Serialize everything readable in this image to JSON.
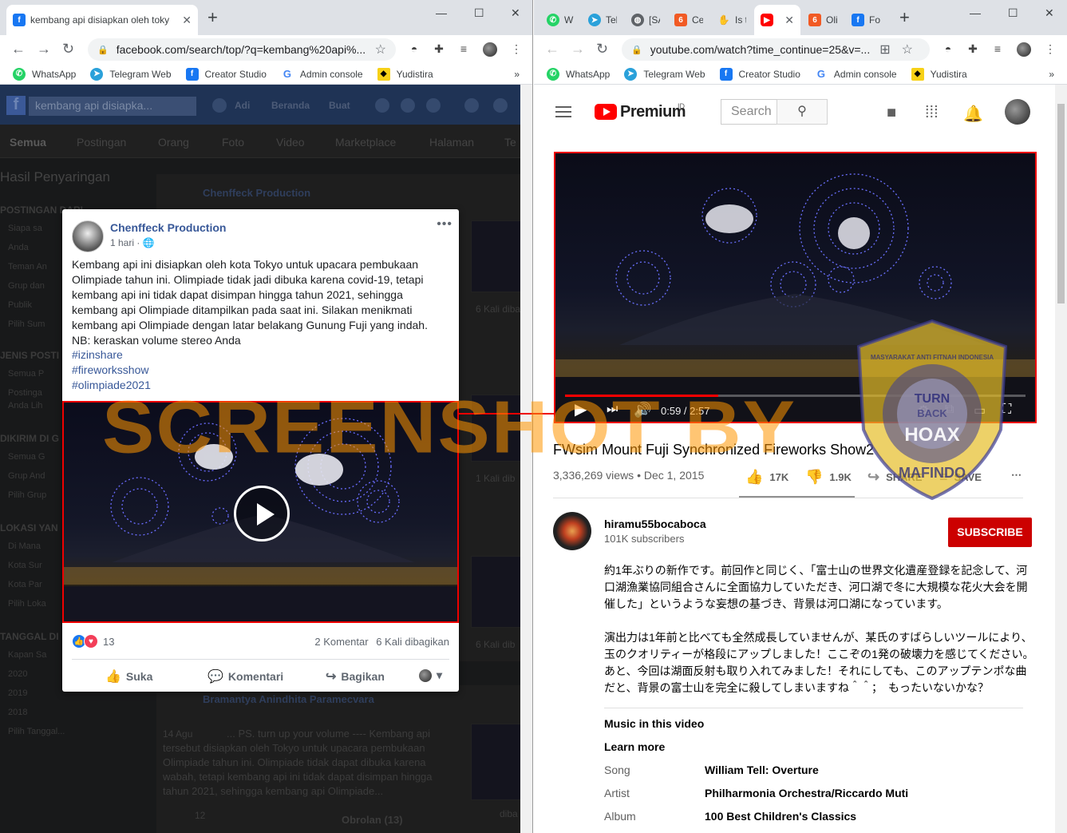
{
  "left_window": {
    "tab_title": "kembang api disiapkan oleh toky",
    "url": "facebook.com/search/top/?q=kembang%20api%...",
    "bookmarks": [
      "WhatsApp",
      "Telegram Web",
      "Creator Studio",
      "Admin console",
      "Yudistira"
    ]
  },
  "right_window": {
    "tabs": [
      "Wh",
      "Tel",
      "[SA",
      "Ce",
      "Is t",
      "",
      "Oli",
      "Fo"
    ],
    "url": "youtube.com/watch?time_continue=25&v=...",
    "bookmarks": [
      "WhatsApp",
      "Telegram Web",
      "Creator Studio",
      "Admin console",
      "Yudistira"
    ]
  },
  "fb_background": {
    "search_text": "kembang api disiapka...",
    "nav": [
      "Adi",
      "Beranda",
      "Buat"
    ],
    "tabs": [
      "Semua",
      "Postingan",
      "Orang",
      "Foto",
      "Video",
      "Marketplace",
      "Halaman",
      "Te"
    ],
    "filters_heading": "Hasil Penyaringan",
    "sections": [
      {
        "title": "POSTINGAN DARI",
        "items": [
          "Siapa sa",
          "Anda",
          "Teman An",
          "Grup dan",
          "Publik",
          "Pilih Sum"
        ]
      },
      {
        "title": "JENIS POSTI",
        "items": [
          "Semua P",
          "Postinga",
          "Anda Lih"
        ]
      },
      {
        "title": "DIKIRIM DI G",
        "items": [
          "Semua G",
          "Grup And",
          "Pilih Grup"
        ]
      },
      {
        "title": "LOKASI YAN",
        "items": [
          "Di Mana",
          "Kota Sur",
          "Kota Par",
          "Pilih Loka"
        ]
      },
      {
        "title": "TANGGAL DI",
        "items": [
          "Kapan Sa",
          "2020",
          "2019",
          "2018",
          "Pilih Tanggal..."
        ]
      }
    ],
    "post1_name": "Chenffeck Production",
    "post1_side_1": "6 Kali diba",
    "post1_side_2": "1 Kali dib",
    "post1_side_3": "6 Kali dib",
    "post2_name": "Bramantya Anindhita Paramecvara",
    "post2_date": "14 Agu",
    "post2_text": "... PS. turn up your volume ---- Kembang api tersebut disiapkan oleh Tokyo untuk upacara pembukaan Olimpiade tahun ini. Olimpiade tidak dapat dibuka karena wabah, tetapi kembang api ini tidak dapat disimpan hingga tahun 2021, sehingga kembang api Olimpiade...",
    "post2_count": "12",
    "chat_label": "Obrolan (13)",
    "chat_side": "diba"
  },
  "fb_post": {
    "author": "Chenffeck Production",
    "time": "1 hari",
    "text": "Kembang api ini disiapkan oleh kota Tokyo untuk upacara pembukaan Olimpiade tahun ini. Olimpiade tidak jadi dibuka karena covid-19, tetapi kembang api ini tidak dapat disimpan hingga tahun 2021, sehingga kembang api Olimpiade ditampilkan pada saat ini. Silakan menikmati kembang api Olimpiade dengan latar belakang Gunung Fuji yang indah. NB: keraskan volume stereo Anda",
    "hashtags": [
      "#izinshare",
      "#fireworksshow",
      "#olimpiade2021"
    ],
    "reactions_count": "13",
    "comments": "2 Komentar",
    "shares": "6 Kali dibagikan",
    "actions": [
      "Suka",
      "Komentari",
      "Bagikan"
    ]
  },
  "yt": {
    "logo_text": "Premium",
    "logo_region": "ID",
    "search_placeholder": "Search",
    "time_display": "0:59 / 2:57",
    "progress_fraction": 0.333,
    "title": "FWsim Mount Fuji Synchronized Fireworks Show2",
    "views_date": "3,336,269 views • Dec 1, 2015",
    "likes": "17K",
    "dislikes": "1.9K",
    "share": "SHARE",
    "save": "SAVE",
    "channel": "hiramu55bocaboca",
    "subscribers": "101K subscribers",
    "subscribe": "SUBSCRIBE",
    "desc_p1": "約1年ぶりの新作です。前回作と同じく、「富士山の世界文化遺産登録を記念して、河口湖漁業協同組合さんに全面協力していただき、河口湖で冬に大規模な花火大会を開催した」というような妄想の基づき、背景は河口湖になっています。",
    "desc_p2": "演出力は1年前と比べても全然成長していませんが、某氏のすばらしいツールにより、玉のクオリティーが格段にアップしました！ここぞの1発の破壊力を感じてください。あと、今回は湖面反射も取り入れてみました！それにしても、このアップテンポな曲だと、背景の富士山を完全に殺してしまいますね＾＾；　もったいないかな？",
    "music_heading": "Music in this video",
    "learn_more": "Learn more",
    "music": [
      {
        "key": "Song",
        "value": "William Tell: Overture"
      },
      {
        "key": "Artist",
        "value": "Philharmonia Orchestra/Riccardo Muti"
      },
      {
        "key": "Album",
        "value": "100 Best Children's Classics"
      }
    ]
  },
  "watermark": {
    "text": "SCREENSHOT BY",
    "badge_top": "MASYARAKAT ANTI FITNAH INDONESIA",
    "badge_center_1": "TURN",
    "badge_center_2": "BACK",
    "badge_center_3": "HOAX",
    "badge_bottom": "MAFINDO"
  },
  "colors": {
    "fb_blue": "#385898",
    "yt_red": "#ff0000",
    "highlight_red": "#e00000",
    "watermark_orange": "#ff9600"
  }
}
